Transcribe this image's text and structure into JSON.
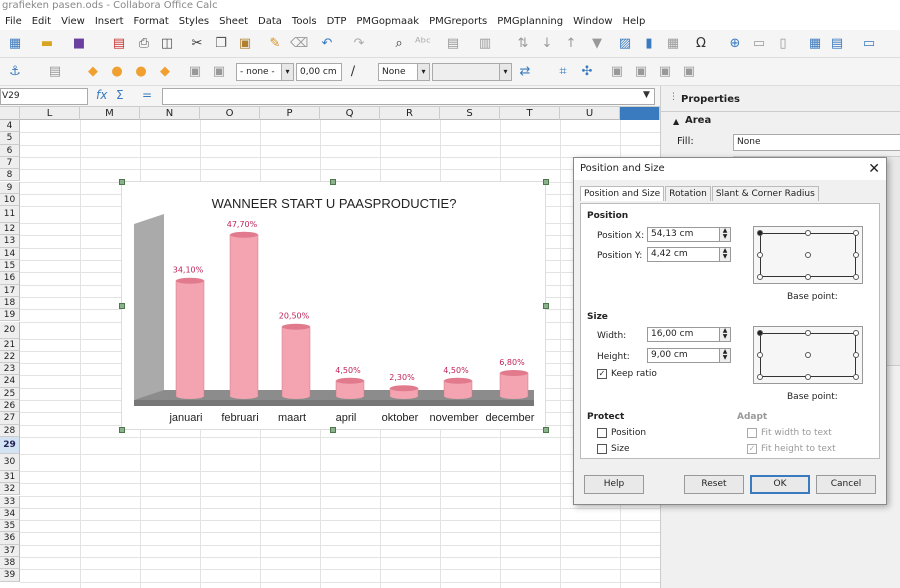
{
  "window_title": "grafieken pasen.ods - Collabora Office Calc",
  "menu": [
    "File",
    "Edit",
    "View",
    "Insert",
    "Format",
    "Styles",
    "Sheet",
    "Data",
    "Tools",
    "DTP",
    "PMGopmaak",
    "PMGreports",
    "PMGplanning",
    "Window",
    "Help"
  ],
  "toolbar2": {
    "line_style": "- none -",
    "line_width": "0,00 cm",
    "area_style": "None"
  },
  "name_box": "V29",
  "columns": [
    "L",
    "M",
    "N",
    "O",
    "P",
    "Q",
    "R",
    "S",
    "T",
    "U"
  ],
  "rows": [
    "4",
    "5",
    "6",
    "7",
    "8",
    "9",
    "10",
    "11",
    "12",
    "13",
    "14",
    "15",
    "16",
    "17",
    "18",
    "19",
    "20",
    "21",
    "22",
    "23",
    "24",
    "25",
    "26",
    "27",
    "28",
    "29",
    "30",
    "31",
    "32",
    "33",
    "34",
    "35",
    "36",
    "37",
    "38",
    "39"
  ],
  "sidebar": {
    "title": "Properties",
    "section": "Area",
    "fill_label": "Fill:",
    "fill_value": "None"
  },
  "chart_data": {
    "type": "bar",
    "title": "WANNEER START U PAASPRODUCTIE?",
    "categories": [
      "januari",
      "februari",
      "maart",
      "april",
      "oktober",
      "november",
      "december"
    ],
    "values": [
      34.1,
      47.7,
      20.5,
      4.5,
      2.3,
      4.5,
      6.8
    ],
    "data_labels": [
      "34,10%",
      "47,70%",
      "20,50%",
      "4,50%",
      "2,30%",
      "4,50%",
      "6,80%"
    ],
    "xlabel": "",
    "ylabel": "",
    "ylim": [
      0,
      50
    ],
    "bar_color": "#f4a3b0",
    "label_color": "#c0245a"
  },
  "dialog": {
    "title": "Position and Size",
    "tabs": [
      "Position and Size",
      "Rotation",
      "Slant & Corner Radius"
    ],
    "position_header": "Position",
    "pos_x_label": "Position X:",
    "pos_x_value": "54,13 cm",
    "pos_y_label": "Position Y:",
    "pos_y_value": "4,42 cm",
    "size_header": "Size",
    "width_label": "Width:",
    "width_value": "16,00 cm",
    "height_label": "Height:",
    "height_value": "9,00 cm",
    "keep_ratio_label": "Keep ratio",
    "base_point_label": "Base point:",
    "protect_header": "Protect",
    "protect_position": "Position",
    "protect_size": "Size",
    "adapt_header": "Adapt",
    "fit_width": "Fit width to text",
    "fit_height": "Fit height to text",
    "help_btn": "Help",
    "reset_btn": "Reset",
    "ok_btn": "OK",
    "cancel_btn": "Cancel"
  }
}
